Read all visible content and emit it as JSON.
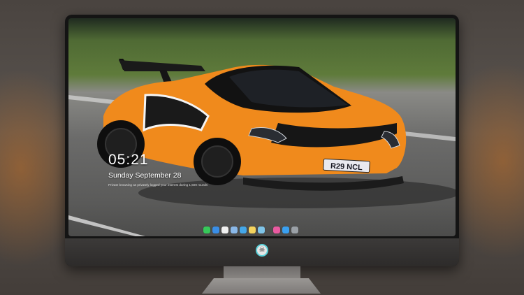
{
  "lock_screen": {
    "time": "05:21",
    "date": "Sunday September  28",
    "notice": "Private browsing as privately logged your interest during 1,500 rounds"
  },
  "plate": {
    "text": "R29 NCL"
  },
  "dock": {
    "items": [
      {
        "name": "messages-icon",
        "color": "#37c85a"
      },
      {
        "name": "finder-icon",
        "color": "#3a8ee6"
      },
      {
        "name": "safari-icon",
        "color": "#f0f0f0"
      },
      {
        "name": "photos-icon",
        "color": "#8ab8e8"
      },
      {
        "name": "appstore-icon",
        "color": "#45a7e8"
      },
      {
        "name": "notes-icon",
        "color": "#f4d35e"
      },
      {
        "name": "preview-icon",
        "color": "#7fc4e8"
      },
      {
        "name": "music-icon",
        "color": "#e85aa0"
      },
      {
        "name": "store-icon",
        "color": "#3aa0f0"
      },
      {
        "name": "camera-icon",
        "color": "#9aa0a6"
      }
    ]
  },
  "colors": {
    "car_orange": "#f08a1c",
    "bezel": "#141414"
  }
}
